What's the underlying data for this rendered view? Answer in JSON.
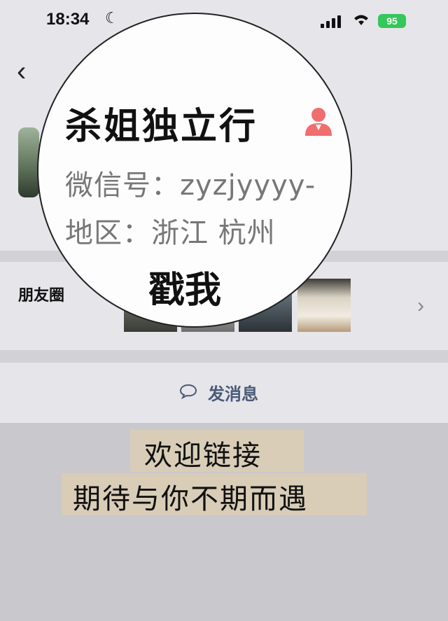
{
  "status_bar": {
    "time": "18:34",
    "battery": "95"
  },
  "profile": {
    "name": "杀姐独立行",
    "wechat_id": "微信号：zyzjyyyy-",
    "region": "地区：浙江 杭州",
    "sticker": "戳我"
  },
  "moments": {
    "label": "朋友圈"
  },
  "actions": {
    "send_message": "发消息"
  },
  "banner": {
    "line1": "欢迎链接",
    "line2": "期待与你不期而遇"
  },
  "colors": {
    "battery_green": "#34c759",
    "send_text": "#4a5a78",
    "person_icon": "#f06e6e",
    "paper": "#d9cdb8"
  }
}
